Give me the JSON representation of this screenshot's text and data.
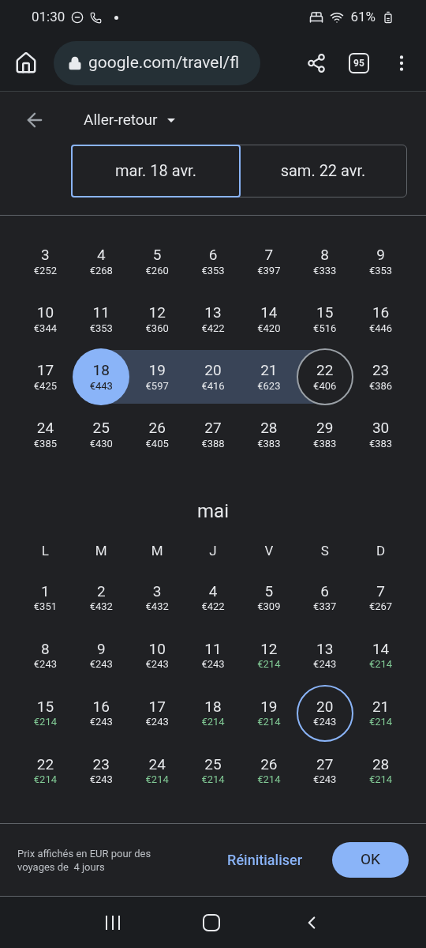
{
  "status_bar": {
    "time": "01:30",
    "battery": "61%"
  },
  "browser": {
    "url": "google.com/travel/fl",
    "tab_count": "95"
  },
  "header": {
    "trip_type": "Aller-retour",
    "dates": [
      {
        "label": "mar. 18 avr.",
        "selected": true
      },
      {
        "label": "sam. 22 avr.",
        "selected": false
      }
    ]
  },
  "months": [
    {
      "days": [
        {
          "day": "3",
          "price": "€252",
          "kind": "plain",
          "cheap": false
        },
        {
          "day": "4",
          "price": "€268",
          "kind": "plain",
          "cheap": false
        },
        {
          "day": "5",
          "price": "€260",
          "kind": "plain",
          "cheap": false
        },
        {
          "day": "6",
          "price": "€353",
          "kind": "plain",
          "cheap": false
        },
        {
          "day": "7",
          "price": "€397",
          "kind": "plain",
          "cheap": false
        },
        {
          "day": "8",
          "price": "€333",
          "kind": "plain",
          "cheap": false
        },
        {
          "day": "9",
          "price": "€353",
          "kind": "plain",
          "cheap": false
        },
        {
          "day": "10",
          "price": "€344",
          "kind": "plain",
          "cheap": false
        },
        {
          "day": "11",
          "price": "€353",
          "kind": "plain",
          "cheap": false
        },
        {
          "day": "12",
          "price": "€360",
          "kind": "plain",
          "cheap": false
        },
        {
          "day": "13",
          "price": "€422",
          "kind": "plain",
          "cheap": false
        },
        {
          "day": "14",
          "price": "€420",
          "kind": "plain",
          "cheap": false
        },
        {
          "day": "15",
          "price": "€516",
          "kind": "plain",
          "cheap": false
        },
        {
          "day": "16",
          "price": "€446",
          "kind": "plain",
          "cheap": false
        },
        {
          "day": "17",
          "price": "€425",
          "kind": "plain",
          "cheap": false
        },
        {
          "day": "18",
          "price": "€443",
          "kind": "start",
          "cheap": false
        },
        {
          "day": "19",
          "price": "€597",
          "kind": "middle",
          "cheap": false
        },
        {
          "day": "20",
          "price": "€416",
          "kind": "middle",
          "cheap": false
        },
        {
          "day": "21",
          "price": "€623",
          "kind": "middle",
          "cheap": false
        },
        {
          "day": "22",
          "price": "€406",
          "kind": "end",
          "cheap": false
        },
        {
          "day": "23",
          "price": "€386",
          "kind": "plain",
          "cheap": false
        },
        {
          "day": "24",
          "price": "€385",
          "kind": "plain",
          "cheap": false
        },
        {
          "day": "25",
          "price": "€430",
          "kind": "plain",
          "cheap": false
        },
        {
          "day": "26",
          "price": "€405",
          "kind": "plain",
          "cheap": false
        },
        {
          "day": "27",
          "price": "€388",
          "kind": "plain",
          "cheap": false
        },
        {
          "day": "28",
          "price": "€383",
          "kind": "plain",
          "cheap": false
        },
        {
          "day": "29",
          "price": "€383",
          "kind": "plain",
          "cheap": false
        },
        {
          "day": "30",
          "price": "€383",
          "kind": "plain",
          "cheap": false
        }
      ]
    },
    {
      "title": "mai",
      "weekdays": [
        "L",
        "M",
        "M",
        "J",
        "V",
        "S",
        "D"
      ],
      "days": [
        {
          "day": "1",
          "price": "€351",
          "kind": "plain",
          "cheap": false
        },
        {
          "day": "2",
          "price": "€432",
          "kind": "plain",
          "cheap": false
        },
        {
          "day": "3",
          "price": "€432",
          "kind": "plain",
          "cheap": false
        },
        {
          "day": "4",
          "price": "€422",
          "kind": "plain",
          "cheap": false
        },
        {
          "day": "5",
          "price": "€309",
          "kind": "plain",
          "cheap": false
        },
        {
          "day": "6",
          "price": "€337",
          "kind": "plain",
          "cheap": false
        },
        {
          "day": "7",
          "price": "€267",
          "kind": "plain",
          "cheap": false
        },
        {
          "day": "8",
          "price": "€243",
          "kind": "plain",
          "cheap": false
        },
        {
          "day": "9",
          "price": "€243",
          "kind": "plain",
          "cheap": false
        },
        {
          "day": "10",
          "price": "€243",
          "kind": "plain",
          "cheap": false
        },
        {
          "day": "11",
          "price": "€243",
          "kind": "plain",
          "cheap": false
        },
        {
          "day": "12",
          "price": "€214",
          "kind": "plain",
          "cheap": true
        },
        {
          "day": "13",
          "price": "€243",
          "kind": "plain",
          "cheap": false
        },
        {
          "day": "14",
          "price": "€214",
          "kind": "plain",
          "cheap": true
        },
        {
          "day": "15",
          "price": "€214",
          "kind": "plain",
          "cheap": true
        },
        {
          "day": "16",
          "price": "€243",
          "kind": "plain",
          "cheap": false
        },
        {
          "day": "17",
          "price": "€243",
          "kind": "plain",
          "cheap": false
        },
        {
          "day": "18",
          "price": "€214",
          "kind": "plain",
          "cheap": true
        },
        {
          "day": "19",
          "price": "€214",
          "kind": "plain",
          "cheap": true
        },
        {
          "day": "20",
          "price": "€243",
          "kind": "ring",
          "cheap": false
        },
        {
          "day": "21",
          "price": "€214",
          "kind": "plain",
          "cheap": true
        },
        {
          "day": "22",
          "price": "€214",
          "kind": "plain",
          "cheap": true
        },
        {
          "day": "23",
          "price": "€243",
          "kind": "plain",
          "cheap": false
        },
        {
          "day": "24",
          "price": "€214",
          "kind": "plain",
          "cheap": true
        },
        {
          "day": "25",
          "price": "€214",
          "kind": "plain",
          "cheap": true
        },
        {
          "day": "26",
          "price": "€214",
          "kind": "plain",
          "cheap": true
        },
        {
          "day": "27",
          "price": "€243",
          "kind": "plain",
          "cheap": false
        },
        {
          "day": "28",
          "price": "€214",
          "kind": "plain",
          "cheap": true
        }
      ]
    }
  ],
  "footer": {
    "note": "Prix affichés en EUR pour des voyages de  4 jours",
    "reset": "Réinitialiser",
    "ok": "OK"
  }
}
